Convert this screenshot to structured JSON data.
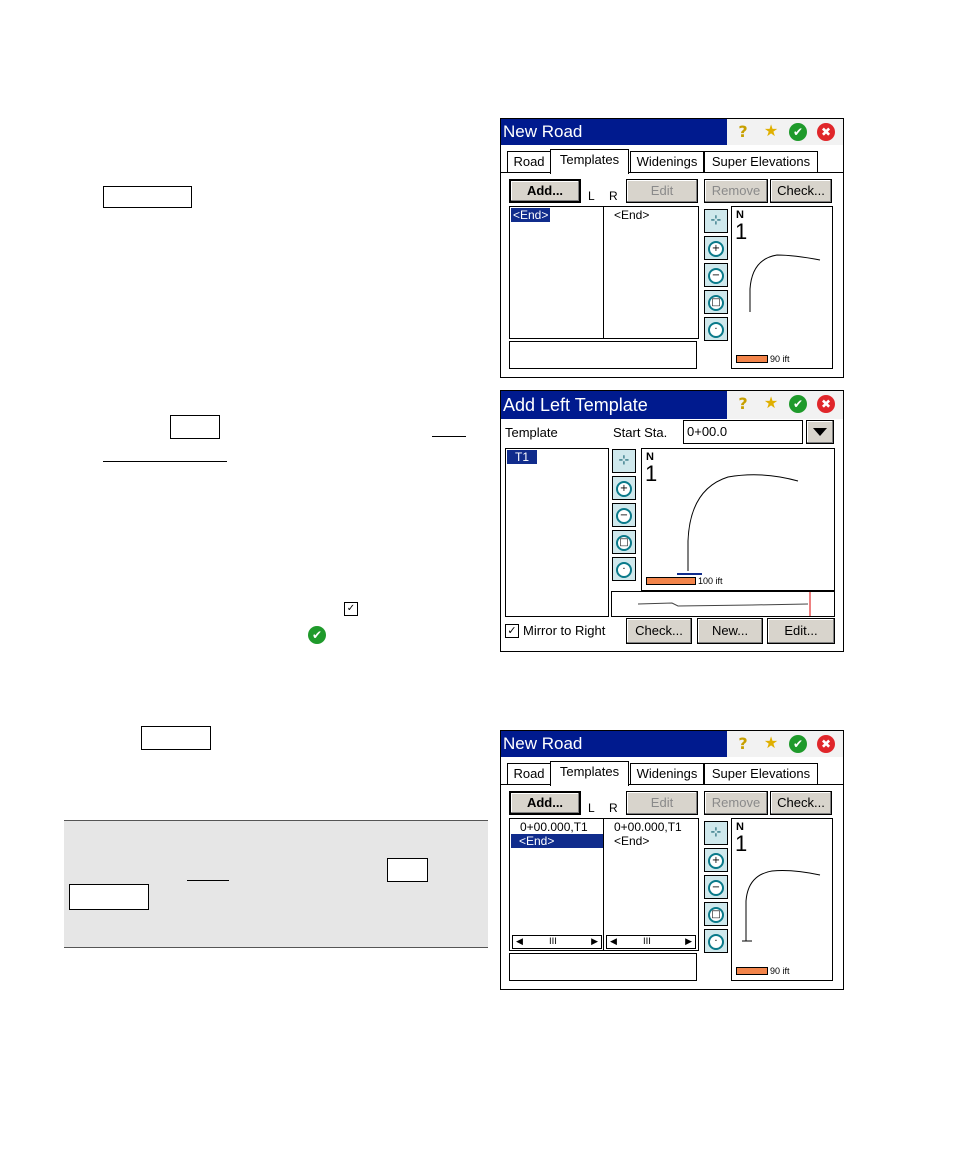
{
  "window1": {
    "title": "New Road",
    "tabs": [
      "Road",
      "Templates",
      "Widenings",
      "Super Elevations"
    ],
    "buttons": {
      "add": "Add...",
      "edit": "Edit",
      "remove": "Remove",
      "check": "Check..."
    },
    "col_left": "L",
    "col_right": "R",
    "left_items": [
      "<End>"
    ],
    "right_items": [
      "<End>"
    ],
    "scale": "90 ift"
  },
  "window2": {
    "title": "Add Left Template",
    "template_label": "Template",
    "start_sta_label": "Start Sta.",
    "start_sta_value": "0+00.0",
    "list_items": [
      "T1"
    ],
    "scale": "100 ift",
    "mirror_label": "Mirror to Right",
    "mirror_checked": true,
    "buttons": {
      "check": "Check...",
      "new": "New...",
      "edit": "Edit..."
    }
  },
  "window3": {
    "title": "New Road",
    "tabs": [
      "Road",
      "Templates",
      "Widenings",
      "Super Elevations"
    ],
    "buttons": {
      "add": "Add...",
      "edit": "Edit",
      "remove": "Remove",
      "check": "Check..."
    },
    "col_left": "L",
    "col_right": "R",
    "left_items": [
      "0+00.000,T1",
      "<End>"
    ],
    "right_items": [
      "0+00.000,T1",
      "<End>"
    ],
    "scroll_thumb": "III",
    "scale": "90 ift"
  },
  "icons": [
    "help-icon",
    "favorites-star-icon",
    "ok-check-icon",
    "close-x-icon",
    "zoom-extents-icon",
    "zoom-in-icon",
    "zoom-out-icon",
    "zoom-window-icon",
    "zoom-previous-icon",
    "north-arrow-icon"
  ],
  "colors": {
    "titlebar": "#001a8e",
    "selection": "#102c8c",
    "scalebar": "#f2844a",
    "ok": "#1f9a2b",
    "close": "#e0262a",
    "note_bg": "#e6e6e6"
  }
}
